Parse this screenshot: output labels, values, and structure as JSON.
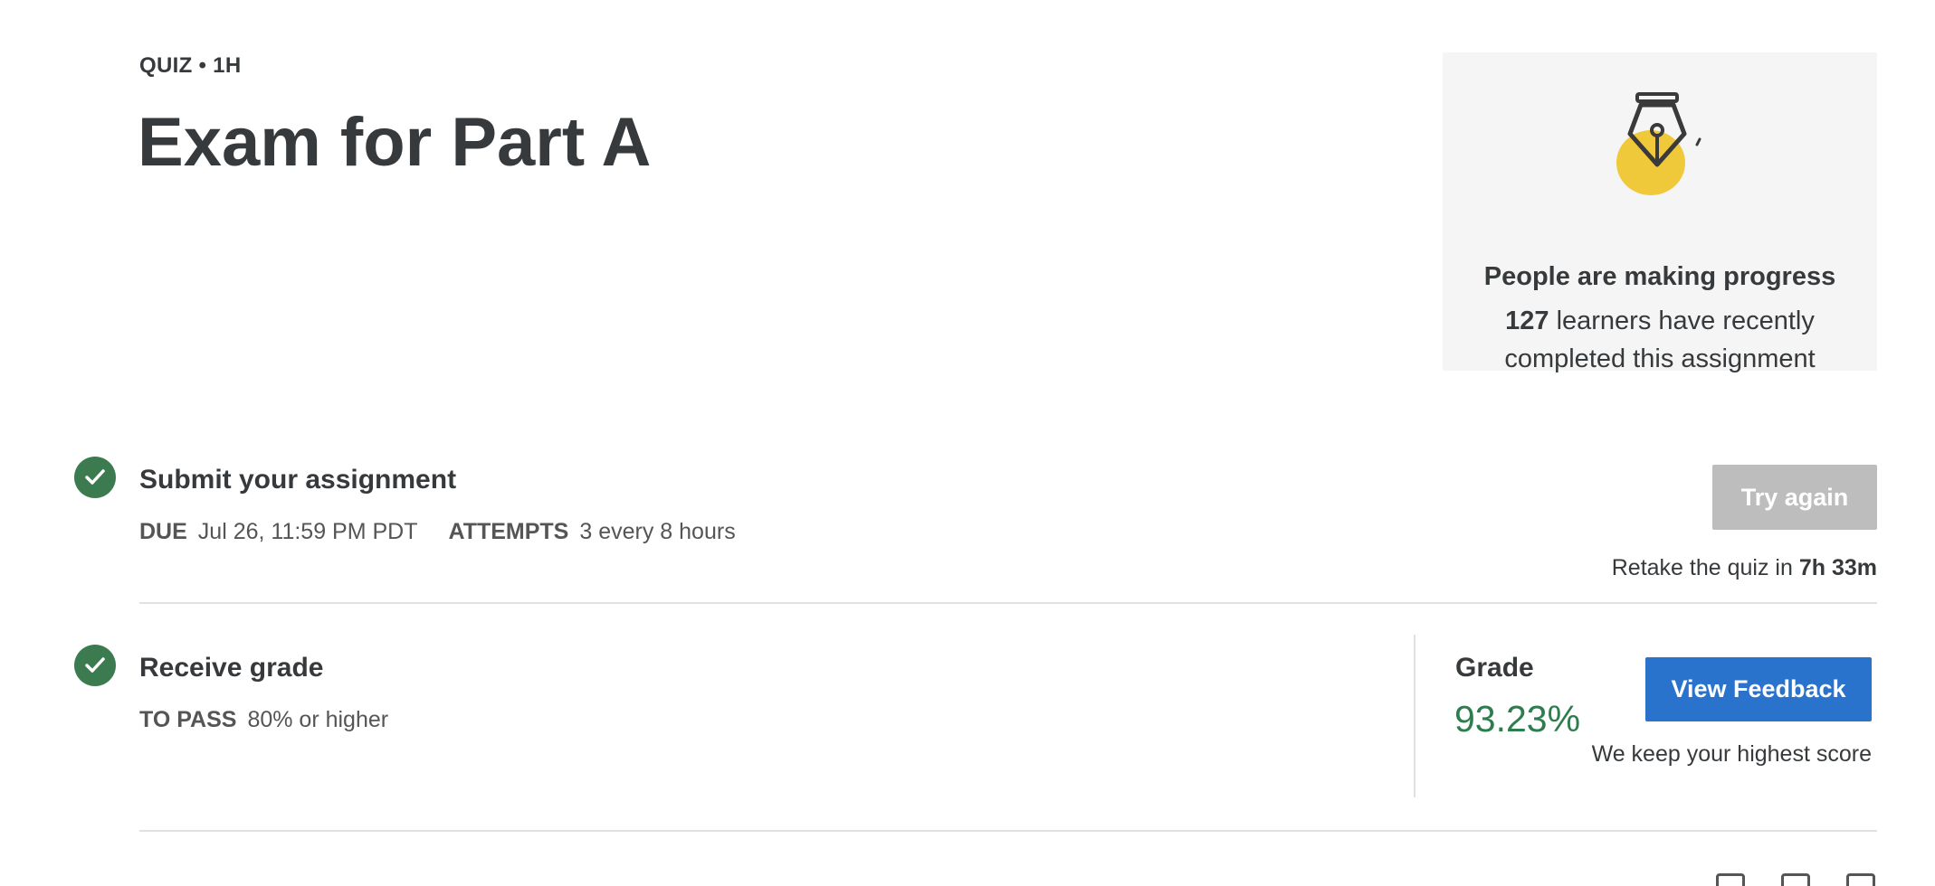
{
  "header": {
    "eyebrow": "QUIZ • 1H",
    "title": "Exam for Part A"
  },
  "progress_card": {
    "icon": "fountain-pen-icon",
    "title": "People are making progress",
    "count": "127",
    "text_line1": "learners have recently",
    "text_line2": "completed this assignment"
  },
  "submit_step": {
    "title": "Submit your assignment",
    "due_label": "DUE",
    "due_value": "Jul 26, 11:59 PM PDT",
    "attempts_label": "ATTEMPTS",
    "attempts_value": "3 every 8 hours",
    "status_icon": "check-circle-icon",
    "try_again_label": "Try again",
    "retake_text": "Retake the quiz in",
    "retake_time": "7h 33m"
  },
  "grade_step": {
    "title": "Receive grade",
    "to_pass_label": "TO PASS",
    "to_pass_value": "80% or higher",
    "status_icon": "check-circle-icon",
    "grade_label": "Grade",
    "grade_value": "93.23%",
    "view_feedback_label": "View Feedback",
    "note": "We keep your highest score"
  },
  "colors": {
    "success": "#3c7a4f",
    "grade": "#2e7d4f",
    "primary_button": "#2a73cc",
    "disabled_button": "#bdbdbd",
    "card_bg": "#f5f5f5",
    "accent_yellow": "#f0c93a"
  }
}
